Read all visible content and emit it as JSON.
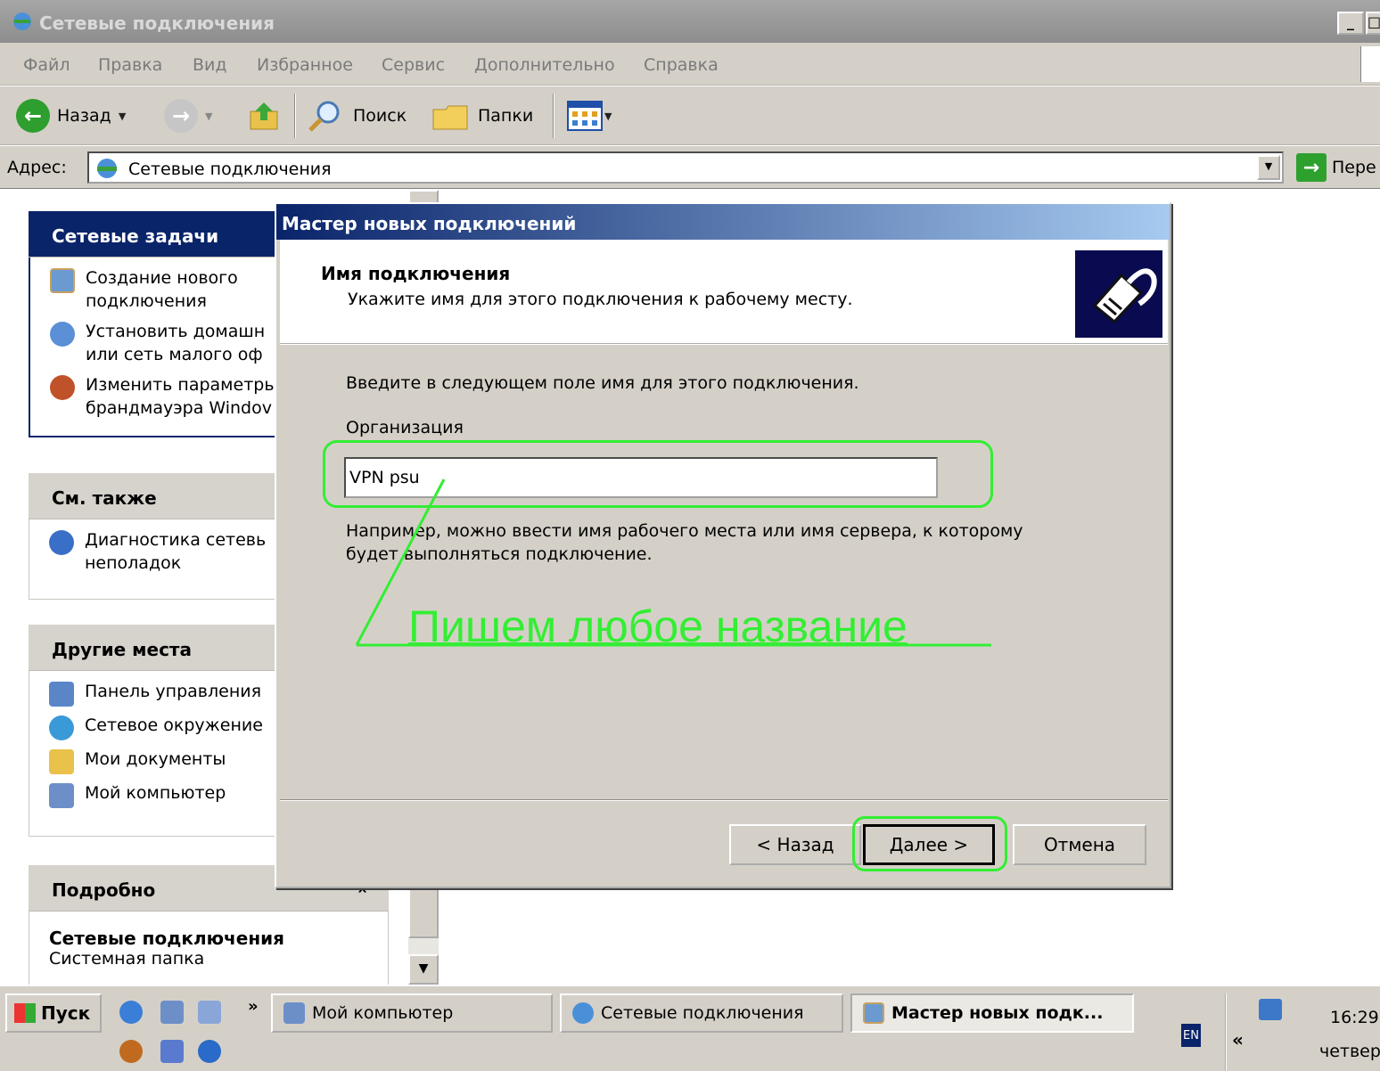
{
  "window": {
    "title": "Сетевые подключения",
    "btn_minimize": "_",
    "btn_maximize": "□"
  },
  "menu": [
    "Файл",
    "Правка",
    "Вид",
    "Избранное",
    "Сервис",
    "Дополнительно",
    "Справка"
  ],
  "toolbar": {
    "back_label": "Назад",
    "search_label": "Поиск",
    "folders_label": "Папки"
  },
  "address": {
    "label": "Адрес:",
    "value": "Сетевые подключения",
    "go_label": "Пере"
  },
  "taskpane": {
    "network_tasks": {
      "title": "Сетевые задачи",
      "items": [
        "Создание нового\nподключения",
        "Установить домашн\nили сеть малого оф",
        "Изменить параметры\nбрандмауэра Windov"
      ]
    },
    "see_also": {
      "title": "См. также",
      "items": [
        "Диагностика сетевь\nнеполадок"
      ]
    },
    "other_places": {
      "title": "Другие места",
      "items": [
        "Панель управления",
        "Сетевое окружение",
        "Мои документы",
        "Мой компьютер"
      ]
    },
    "details": {
      "title": "Подробно",
      "collapse_glyph": "«",
      "name": "Сетевые подключения",
      "type": "Системная папка"
    }
  },
  "scrollbar": {
    "down_arrow": "▼"
  },
  "wizard": {
    "title": "Мастер новых подключений",
    "header_title": "Имя подключения",
    "header_subtitle": "Укажите имя для этого подключения к рабочему месту.",
    "intro": "Введите в следующем поле имя для этого подключения.",
    "field_label": "Организация",
    "field_value": "VPN psu",
    "hint": "Например, можно ввести имя рабочего места или имя сервера, к которому\nбудет выполняться подключение.",
    "btn_back": "< Назад",
    "btn_next": "Далее >",
    "btn_cancel": "Отмена"
  },
  "annotation": {
    "text": "Пишем любое название",
    "color": "#33ee33"
  },
  "taskbar": {
    "start_label": "Пуск",
    "more_glyph": "»",
    "tasks": [
      "Мой компьютер",
      "Сетевые подключения",
      "Мастер новых подк..."
    ],
    "lang": "EN",
    "tray_chevron": "«",
    "time": "16:29",
    "day": "четвер"
  }
}
